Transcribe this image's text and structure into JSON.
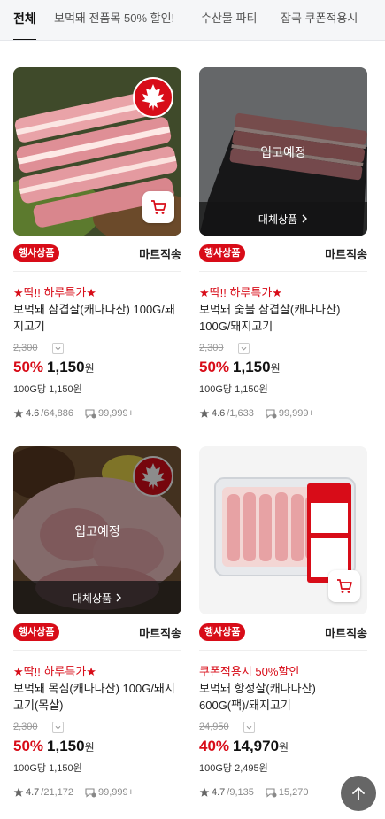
{
  "tabs": [
    "전체",
    "보먹돼 전품목 50% 할인!",
    "수산물 파티",
    "잡곡 쿠폰적용시"
  ],
  "products": [
    {
      "badge": "행사상품",
      "shipping": "마트직송",
      "promo": "★딱!! 하루특가★",
      "name": "보먹돼 삼겹살(캐나다산) 100G/돼지고기",
      "orig_price": "2,300",
      "discount": "50%",
      "price": "1,150",
      "won": "원",
      "unit_price": "100G당 1,150원",
      "rating": "4.6",
      "rating_count": "/64,886",
      "reviews": "99,999+"
    },
    {
      "badge": "행사상품",
      "shipping": "마트직송",
      "promo": "★딱!! 하루특가★",
      "name": "보먹돼 숯불 삼겹살(캐나다산) 100G/돼지고기",
      "orig_price": "2,300",
      "discount": "50%",
      "price": "1,150",
      "won": "원",
      "unit_price": "100G당 1,150원",
      "rating": "4.6",
      "rating_count": "/1,633",
      "reviews": "99,999+",
      "overlay_text": "입고예정",
      "alt_button": "대체상품"
    },
    {
      "badge": "행사상품",
      "shipping": "마트직송",
      "promo": "★딱!! 하루특가★",
      "name": "보먹돼 목심(캐나다산) 100G/돼지고기(목살)",
      "orig_price": "2,300",
      "discount": "50%",
      "price": "1,150",
      "won": "원",
      "unit_price": "100G당 1,150원",
      "rating": "4.7",
      "rating_count": "/21,172",
      "reviews": "99,999+",
      "overlay_text": "입고예정",
      "alt_button": "대체상품"
    },
    {
      "badge": "행사상품",
      "shipping": "마트직송",
      "promo": "쿠폰적용시 50%할인",
      "name": "보먹돼 항정살(캐나다산) 600G(팩)/돼지고기",
      "orig_price": "24,950",
      "discount": "40%",
      "price": "14,970",
      "won": "원",
      "unit_price": "100G당 2,495원",
      "rating": "4.7",
      "rating_count": "/9,135",
      "reviews": "15,270"
    }
  ],
  "colors": {
    "accent": "#d80c18",
    "text": "#111111",
    "muted": "#999999"
  },
  "icons": [
    "maple-leaf-icon",
    "cart-icon",
    "chevron-right-icon",
    "star-icon",
    "review-icon",
    "scroll-top-icon"
  ]
}
